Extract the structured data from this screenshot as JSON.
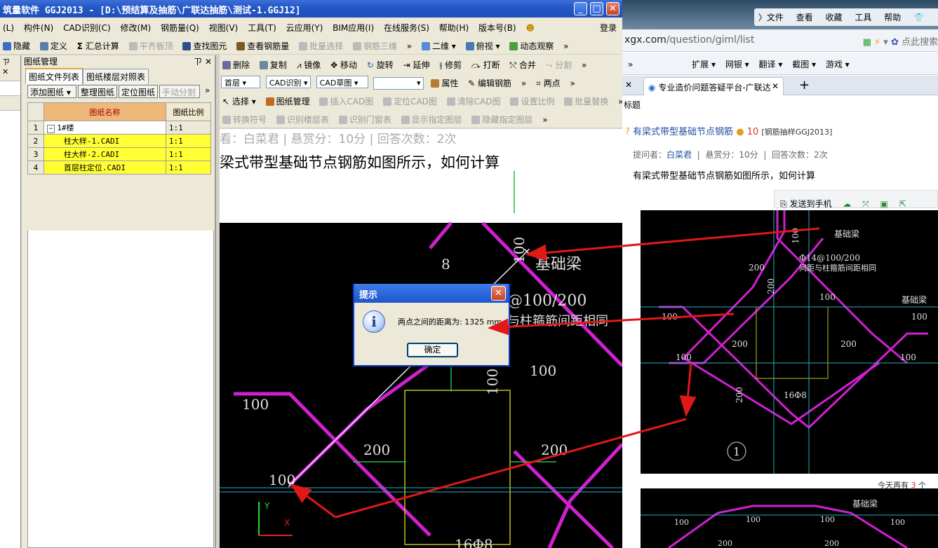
{
  "ggj_window": {
    "title": "筑量软件 GGJ2013 - [D:\\预结算及抽筋\\广联达抽筋\\测试-1.GGJ12]",
    "menu": [
      "(L)",
      "构件(N)",
      "CAD识别(C)",
      "修改(M)",
      "钢筋量(Q)",
      "视图(V)",
      "工具(T)",
      "云应用(Y)",
      "BIM应用(I)",
      "在线服务(S)",
      "帮助(H)",
      "版本号(B)"
    ],
    "login": "登录",
    "toolbar1": {
      "hide": "隐藏",
      "define": "定义",
      "summary": "汇总计算",
      "flat_top": "平齐板顶",
      "find": "查找图元",
      "view_rebar": "查看钢筋量",
      "batch_select": "批量选择",
      "rebar_3d": "钢筋三维",
      "more": "»",
      "view_2d": "二维",
      "top_view": "俯视",
      "dynamic": "动态观察",
      "more2": "»"
    },
    "toolbar2": {
      "delete": "删除",
      "copy": "复制",
      "mirror": "镜像",
      "move": "移动",
      "rotate": "旋转",
      "extend": "延伸",
      "trim": "修剪",
      "break": "打断",
      "merge": "合并",
      "split": "分割",
      "more": "»"
    },
    "toolbar3": {
      "floor": "首层",
      "cad_recog": "CAD识别",
      "cad_draft": "CAD草图",
      "blank": "",
      "props": "属性",
      "edit_rebar": "编辑钢筋",
      "more": "»",
      "two_points": "两点",
      "more2": "»"
    },
    "toolbar4": {
      "select": "选择",
      "drawing_mgmt": "图纸管理",
      "insert_cad": "插入CAD图",
      "locate_cad": "定位CAD图",
      "clear_cad": "清除CAD图",
      "set_scale": "设置比例",
      "batch_replace": "批量替换",
      "more": "»"
    },
    "toolbar5": {
      "convert_symbol": "转换符号",
      "recog_floor_table": "识别楼层表",
      "recog_door_window": "识别门窗表",
      "show_layer": "显示指定图层",
      "hide_layer": "隐藏指定图层",
      "more": "»"
    },
    "left_strip": {
      "header": "ㄗ ✕"
    }
  },
  "drawing_manager": {
    "title": "图纸管理",
    "pin": "ㄗ ✕",
    "tabs": [
      "图纸文件列表",
      "图纸楼层对照表"
    ],
    "buttons": {
      "add": "添加图纸",
      "organize": "整理图纸",
      "locate": "定位图纸",
      "manual_split": "手动分割",
      "more": "»"
    },
    "columns": [
      "图纸名称",
      "图纸比例"
    ],
    "rows": [
      {
        "num": "1",
        "name": "1#楼",
        "scale": "1:1",
        "toggle": "−"
      },
      {
        "num": "2",
        "name": "柱大样-1.CADI",
        "scale": "1:1"
      },
      {
        "num": "3",
        "name": "柱大样-2.CADI",
        "scale": "1:1"
      },
      {
        "num": "4",
        "name": "首层柱定位.CADI",
        "scale": "1:1"
      }
    ]
  },
  "canvas": {
    "question_text": "梁式带型基础节点钢筋如图所示，如何计算",
    "faded_header": "看：白菜君   |   悬赏分：10分   |   回答次数：2次",
    "labels": {
      "l100a": "100",
      "l100b": "100",
      "l100c": "100",
      "l100d": "100",
      "l100e": "100",
      "l200a": "200",
      "l200b": "200",
      "l8a": "8",
      "rebar_spec": "@100/200",
      "rebar_note": "与柱箍筋间距相同",
      "jcl": "基础梁",
      "rebar_168": "16Φ8"
    },
    "axis_y": "Y",
    "axis_x": "X"
  },
  "dialog": {
    "title": "提示",
    "message": "两点之间的距离为: 1325 mm",
    "ok": "确定",
    "info_glyph": "i",
    "close_glyph": "✕"
  },
  "browser": {
    "menu": [
      "〉文件",
      "查看",
      "收藏",
      "工具",
      "帮助"
    ],
    "url_domain": "xgx.com",
    "url_path": "/question/giml/list",
    "search_placeholder": "点此搜索",
    "ext_items": [
      "»",
      "扩展 ▾",
      "网银 ▾",
      "翻译 ▾",
      "截图 ▾",
      "游戏 ▾"
    ],
    "tab_title": "专业造价问题答疑平台-广联达",
    "tab_close": "✕",
    "new_tab": "+",
    "back_x": "✕",
    "section": "标题",
    "question_title": "有梁式带型基础节点钢筋",
    "points": "10",
    "category": "[钢筋抽样GGJ2013]",
    "asker_label": "提问者：",
    "asker": "白菜君",
    "reward": "悬赏分：10分",
    "answers": "回答次数：2次",
    "body": "有梁式带型基础节点钢筋如图所示，如何计算",
    "send_phone": "发送到手机",
    "today_prefix": "今天再有",
    "today_num": "3",
    "today_suffix": "个",
    "pic_labels": {
      "jcl": "基础梁",
      "spec": "Φ14@100/200",
      "spec_note": "间距与柱箍筋间距相同",
      "v200a": "200",
      "v200b": "200",
      "v200c": "200",
      "v200d": "200",
      "v200e": "200",
      "v100a": "100",
      "v100b": "100",
      "v100c": "100",
      "v100d": "100",
      "v100e": "100",
      "v100f": "100",
      "r168": "16Φ8",
      "circle": "1",
      "jcl2": "基础梁"
    }
  }
}
